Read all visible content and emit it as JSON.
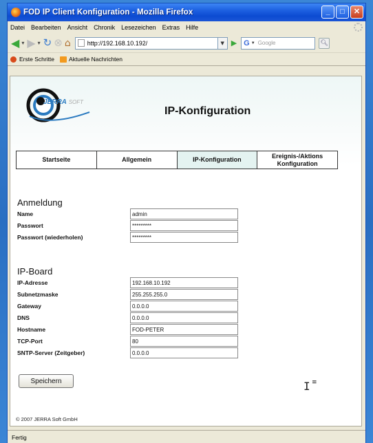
{
  "window": {
    "title": "FOD IP Client Konfiguration - Mozilla Firefox",
    "buttons": {
      "minimize": "_",
      "maximize": "□",
      "close": "✕"
    }
  },
  "menu": [
    "Datei",
    "Bearbeiten",
    "Ansicht",
    "Chronik",
    "Lesezeichen",
    "Extras",
    "Hilfe"
  ],
  "navbar": {
    "url": "http://192.168.10.192/",
    "search_placeholder": "Google",
    "search_engine": "G"
  },
  "bookmarks": [
    "Erste Schritte",
    "Aktuelle Nachrichten"
  ],
  "page": {
    "logo_brand": "JERRA",
    "logo_suffix": "SOFT",
    "title": "IP-Konfiguration",
    "tabs": [
      {
        "label": "Startseite",
        "active": false
      },
      {
        "label": "Allgemein",
        "active": false
      },
      {
        "label": "IP-Konfiguration",
        "active": true
      },
      {
        "label": "Ereignis-/Aktions Konfiguration",
        "active": false
      }
    ],
    "anmeldung": {
      "title": "Anmeldung",
      "fields": [
        {
          "label": "Name",
          "value": "admin"
        },
        {
          "label": "Passwort",
          "value": "*********"
        },
        {
          "label": "Passwort (wiederholen)",
          "value": "*********"
        }
      ]
    },
    "ipboard": {
      "title": "IP-Board",
      "fields": [
        {
          "label": "IP-Adresse",
          "value": "192.168.10.192"
        },
        {
          "label": "Subnetzmaske",
          "value": "255.255.255.0"
        },
        {
          "label": "Gateway",
          "value": "0.0.0.0"
        },
        {
          "label": "DNS",
          "value": "0.0.0.0"
        },
        {
          "label": "Hostname",
          "value": "FOD-PETER"
        },
        {
          "label": "TCP-Port",
          "value": "80"
        },
        {
          "label": "SNTP-Server (Zeitgeber)",
          "value": "0.0.0.0"
        }
      ]
    },
    "save_label": "Speichern",
    "footer": "© 2007 JERRA Soft GmbH"
  },
  "status": "Fertig",
  "colors": {
    "titlebar": "#0c4bd2",
    "active_tab": "#e4f3f1",
    "desktop": "#2a6fc2",
    "logo_accent": "#2a7ac0"
  }
}
